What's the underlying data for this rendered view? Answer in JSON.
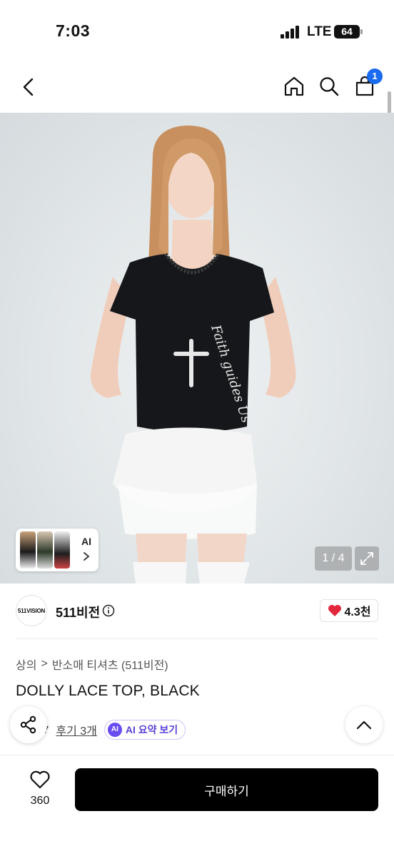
{
  "status_bar": {
    "time": "7:03",
    "network": "LTE",
    "battery": "64"
  },
  "nav": {
    "cart_count": "1"
  },
  "gallery": {
    "thumb_label": "AI",
    "pager": "1 / 4"
  },
  "brand": {
    "logo_text": "511VISION",
    "name": "511비전",
    "likes": "4.3천"
  },
  "breadcrumb": {
    "category": "상의",
    "separator": ">",
    "subcategory": "반소매 티셔츠 (511비전)"
  },
  "product": {
    "title": "DOLLY LACE TOP, BLACK"
  },
  "reviews": {
    "rating_fragment": "7",
    "count_label": "후기 3개",
    "ai_badge": "AI",
    "ai_summary_label": "AI 요약 보기"
  },
  "bottom": {
    "wish_count": "360",
    "buy_label": "구매하기"
  },
  "colors": {
    "accent": "#1a6bf0",
    "like_heart": "#e2263b",
    "ai_purple": "#6a4cf0",
    "buy_button": "#000000"
  },
  "icons": [
    "back-chevron-icon",
    "home-icon",
    "search-icon",
    "cart-icon",
    "info-icon",
    "heart-icon",
    "share-icon",
    "chevron-up-icon",
    "expand-icon",
    "chevron-right-icon"
  ]
}
